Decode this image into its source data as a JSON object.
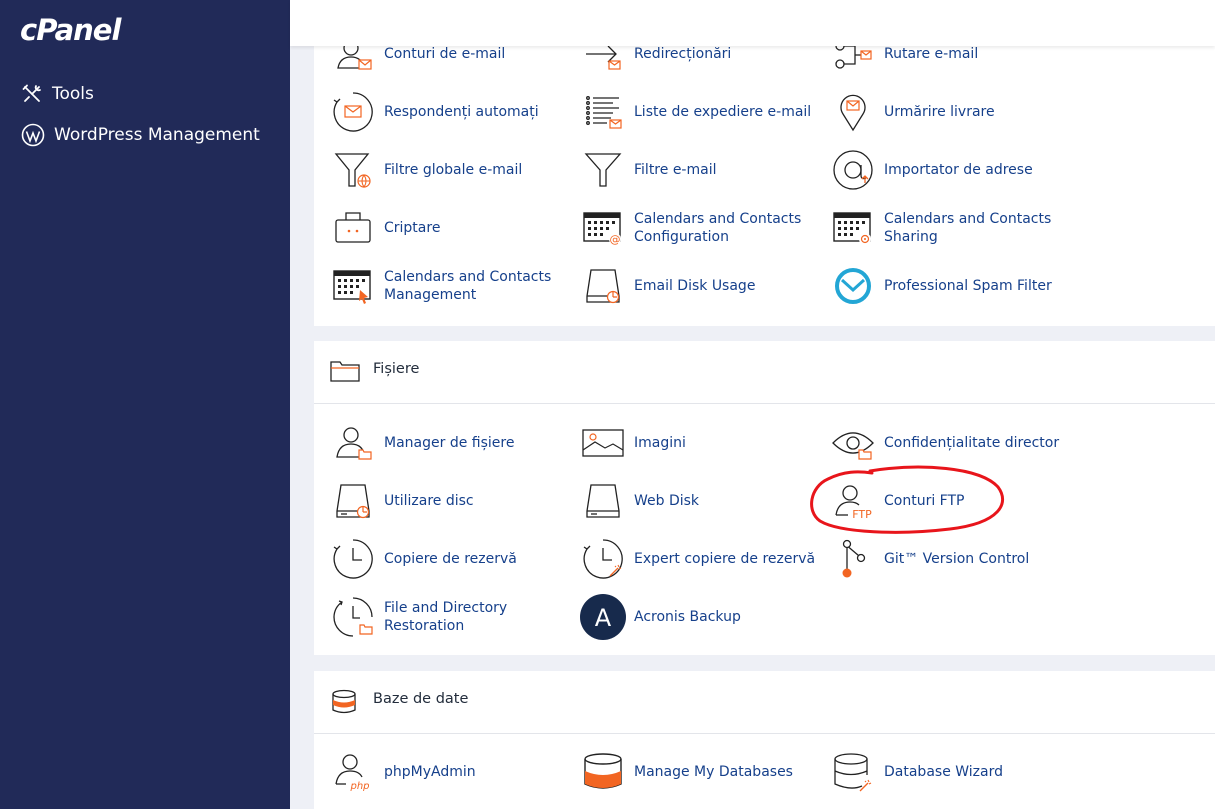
{
  "sidebar": {
    "logo": "cPanel",
    "items": [
      {
        "label": "Tools",
        "icon": "tools-icon"
      },
      {
        "label": "WordPress Management",
        "icon": "wordpress-icon"
      }
    ]
  },
  "email": {
    "items": [
      {
        "label": "Conturi de e-mail",
        "icon": "email-accounts-icon"
      },
      {
        "label": "Redirecționări",
        "icon": "forwarders-icon"
      },
      {
        "label": "Rutare e-mail",
        "icon": "email-routing-icon"
      },
      {
        "label": "Respondenți automați",
        "icon": "autoresponders-icon"
      },
      {
        "label": "Liste de expediere e-mail",
        "icon": "mailing-lists-icon"
      },
      {
        "label": "Urmărire livrare",
        "icon": "track-delivery-icon"
      },
      {
        "label": "Filtre globale e-mail",
        "icon": "global-filter-icon"
      },
      {
        "label": "Filtre e-mail",
        "icon": "email-filter-icon"
      },
      {
        "label": "Importator de adrese",
        "icon": "address-importer-icon"
      },
      {
        "label": "Criptare",
        "icon": "encryption-icon"
      },
      {
        "label": "Calendars and Contacts Configuration",
        "icon": "calendar-config-icon"
      },
      {
        "label": "Calendars and Contacts Sharing",
        "icon": "calendar-sharing-icon"
      },
      {
        "label": "Calendars and Contacts Management",
        "icon": "calendar-management-icon"
      },
      {
        "label": "Email Disk Usage",
        "icon": "email-disk-usage-icon"
      },
      {
        "label": "Professional Spam Filter",
        "icon": "spam-filter-icon"
      }
    ]
  },
  "files": {
    "title": "Fișiere",
    "items": [
      {
        "label": "Manager de fișiere",
        "icon": "file-manager-icon"
      },
      {
        "label": "Imagini",
        "icon": "images-icon"
      },
      {
        "label": "Confidențialitate director",
        "icon": "directory-privacy-icon"
      },
      {
        "label": "Utilizare disc",
        "icon": "disk-usage-icon"
      },
      {
        "label": "Web Disk",
        "icon": "web-disk-icon"
      },
      {
        "label": "Conturi FTP",
        "icon": "ftp-accounts-icon",
        "icon_text": "FTP"
      },
      {
        "label": "Copiere de rezervă",
        "icon": "backup-icon"
      },
      {
        "label": "Expert copiere de rezervă",
        "icon": "backup-wizard-icon"
      },
      {
        "label": "Git™ Version Control",
        "icon": "git-icon"
      },
      {
        "label": "File and Directory Restoration",
        "icon": "file-restoration-icon"
      },
      {
        "label": "Acronis Backup",
        "icon": "acronis-icon",
        "icon_text": "A"
      }
    ]
  },
  "databases": {
    "title": "Baze de date",
    "items": [
      {
        "label": "phpMyAdmin",
        "icon": "phpmyadmin-icon",
        "icon_text": "php"
      },
      {
        "label": "Manage My Databases",
        "icon": "manage-databases-icon"
      },
      {
        "label": "Database Wizard",
        "icon": "database-wizard-icon"
      }
    ]
  },
  "colors": {
    "sidebar": "#212a58",
    "link": "#16408b",
    "accent": "#f26522",
    "highlight": "#e8151b"
  }
}
